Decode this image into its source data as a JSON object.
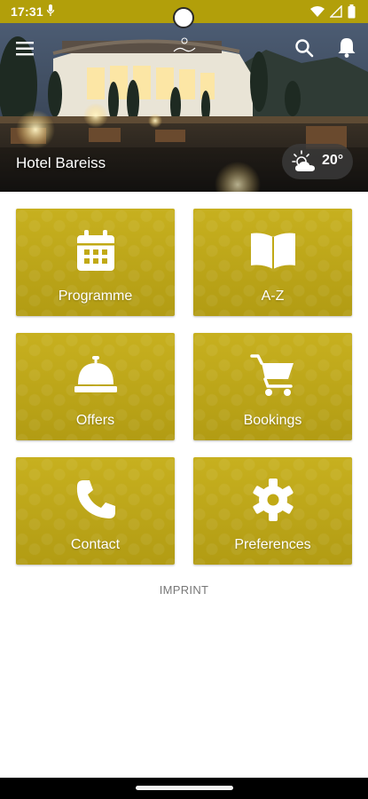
{
  "status_bar": {
    "time": "17:31"
  },
  "header": {
    "hotel_name": "Hotel Bareiss",
    "weather": {
      "temperature": "20°",
      "icon": "partly-cloudy-icon"
    },
    "icons": [
      "menu-icon",
      "logo",
      "search-icon",
      "bell-icon"
    ]
  },
  "tiles": [
    {
      "label": "Programme",
      "icon": "calendar-icon"
    },
    {
      "label": "A-Z",
      "icon": "book-icon"
    },
    {
      "label": "Offers",
      "icon": "service-bell-icon"
    },
    {
      "label": "Bookings",
      "icon": "cart-icon"
    },
    {
      "label": "Contact",
      "icon": "phone-icon"
    },
    {
      "label": "Preferences",
      "icon": "gear-icon"
    }
  ],
  "footer": {
    "imprint": "IMPRINT"
  },
  "colors": {
    "brand": "#c1a915",
    "status_bar": "#b29f0a"
  }
}
